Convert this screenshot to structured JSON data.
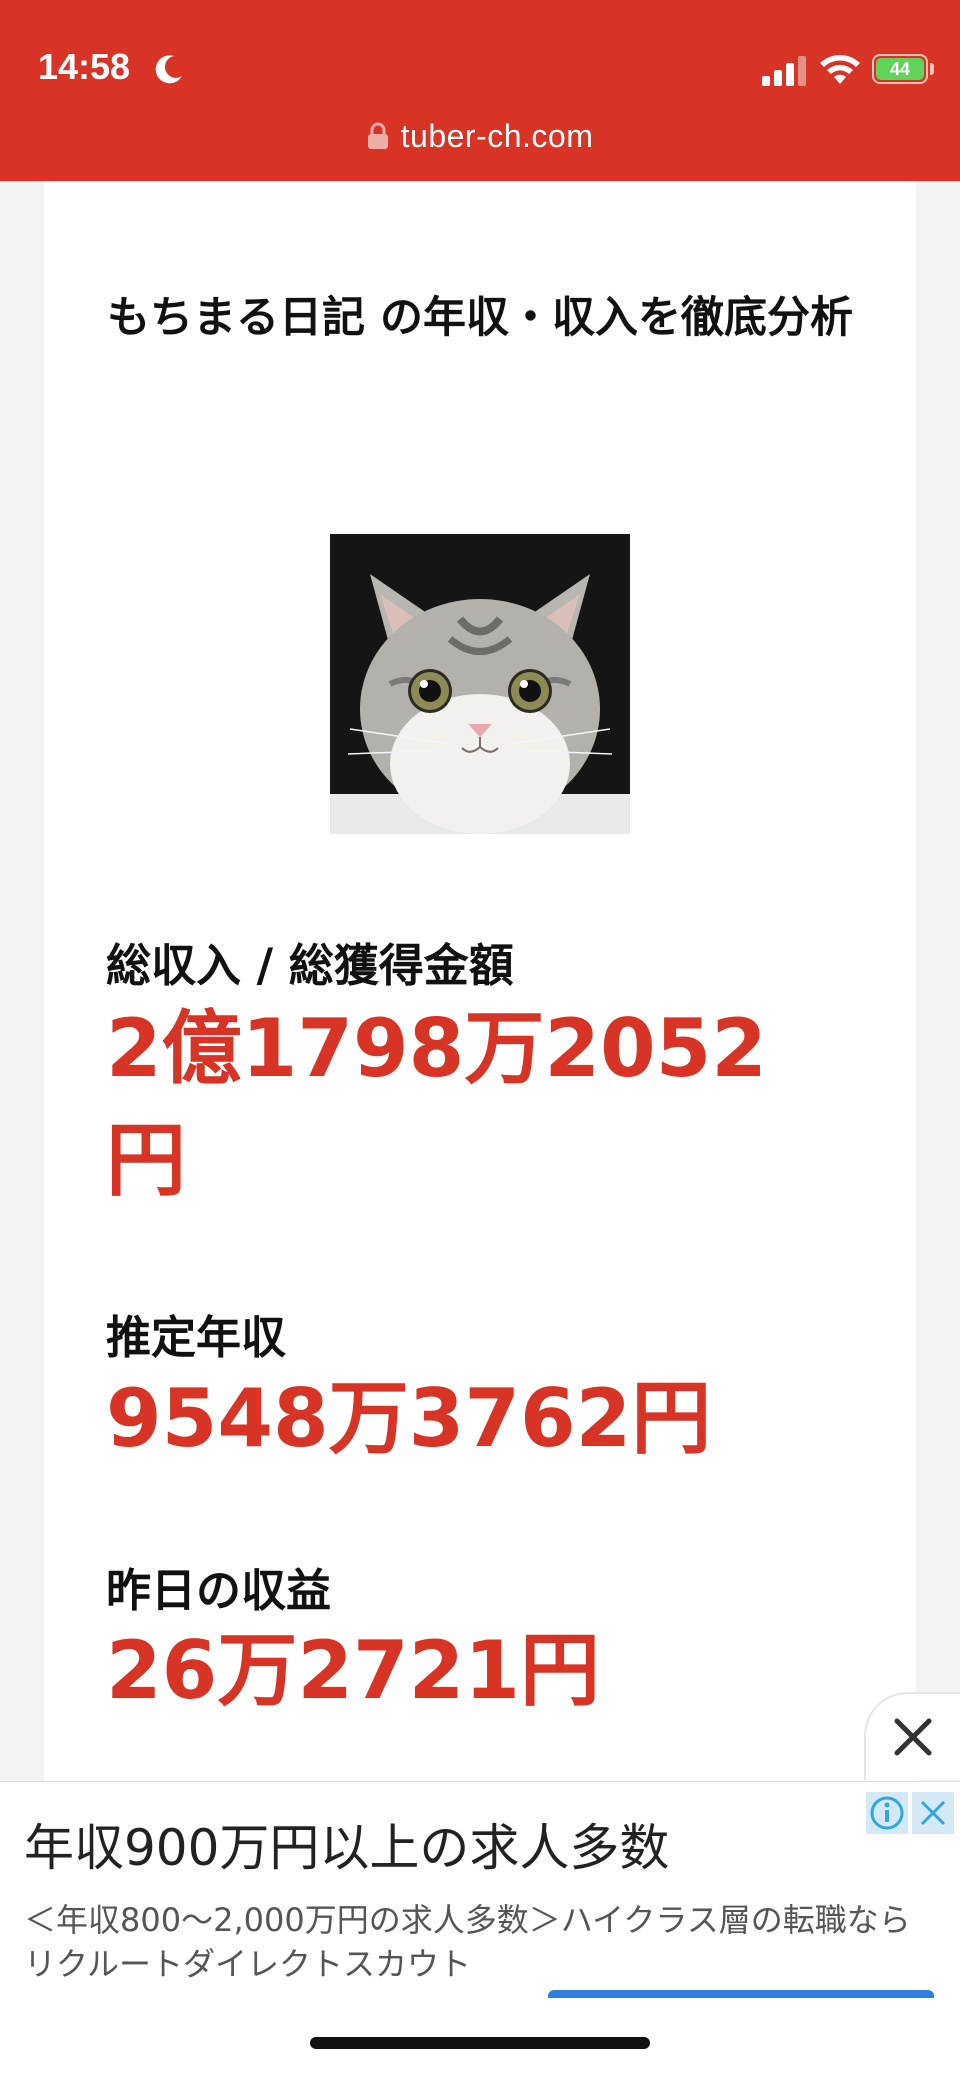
{
  "status_bar": {
    "time": "14:58",
    "battery": "44",
    "icons": [
      "moon-icon",
      "signal-icon",
      "wifi-icon",
      "battery-icon"
    ]
  },
  "browser": {
    "url": "tuber-ch.com"
  },
  "article": {
    "title": "もちまる日記 の年収・収入を徹底分析",
    "stats": [
      {
        "label": "総収入 / 総獲得金額",
        "value": "2億1798万2052円"
      },
      {
        "label": "推定年収",
        "value": "9548万3762円"
      },
      {
        "label": "昨日の収益",
        "value": "26万2721円"
      }
    ]
  },
  "ad": {
    "headline": "年収900万円以上の求人多数",
    "body": "＜年収800〜2,000万円の求人多数＞ハイクラス層の転職ならリクルートダイレクトスカウト"
  },
  "colors": {
    "brand_red": "#d73426",
    "value_red": "#d73426",
    "ad_button_blue": "#2f7fe3"
  }
}
